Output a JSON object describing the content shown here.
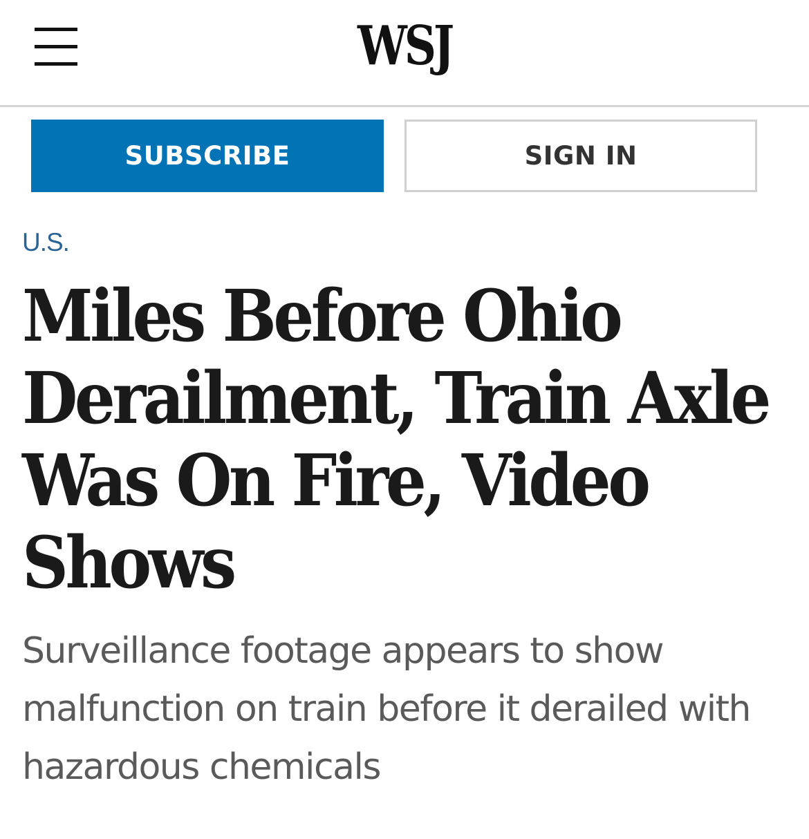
{
  "header": {
    "logo": "WSJ",
    "menu_icon": "hamburger-menu-icon"
  },
  "actions": {
    "subscribe_label": "SUBSCRIBE",
    "signin_label": "SIGN IN"
  },
  "article": {
    "section": "U.S.",
    "headline": "Miles Before Ohio Derailment, Train Axle Was On Fire, Video Shows",
    "dek": "Surveillance footage appears to show malfunction on train before it derailed with hazardous chemicals"
  },
  "colors": {
    "accent": "#0274b6",
    "section_link": "#2a6496",
    "headline": "#1a1a1a",
    "dek": "#5a5a5a"
  }
}
